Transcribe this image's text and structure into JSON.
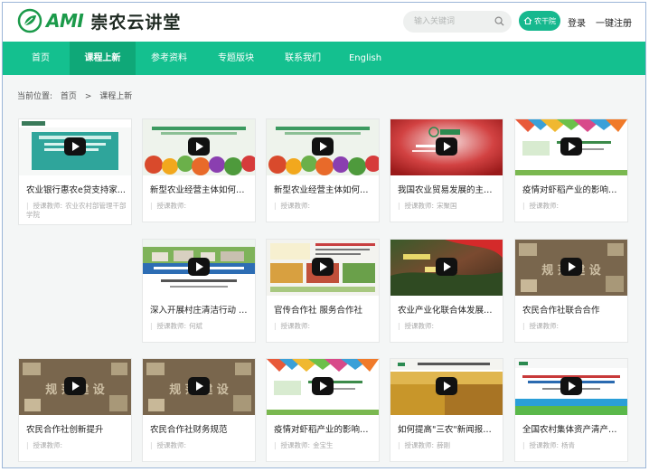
{
  "header": {
    "logo_text": "AMI",
    "site_name": "崇农云讲堂",
    "search_placeholder": "输入关键词",
    "home_button": "农干院",
    "login": "登录",
    "register": "一键注册"
  },
  "nav": {
    "items": [
      {
        "label": "首页",
        "active": false
      },
      {
        "label": "课程上新",
        "active": true
      },
      {
        "label": "参考资料",
        "active": false
      },
      {
        "label": "专题版块",
        "active": false
      },
      {
        "label": "联系我们",
        "active": false
      },
      {
        "label": "English",
        "active": false
      }
    ]
  },
  "breadcrumb": {
    "prefix": "当前位置:",
    "home": "首页",
    "separator": ">",
    "current": "课程上新"
  },
  "colors": {
    "brand_green": "#14c08f",
    "nav_active": "#0fa878",
    "logo_green": "#1b9a4a"
  },
  "courses": [
    {
      "title": "农业银行惠农e贷支持家...",
      "teacher_label": "授课教师:",
      "teacher": "农业农村部管理干部学院",
      "thumb": "teal-slide"
    },
    {
      "title": "新型农业经营主体如何应...",
      "teacher_label": "授课教师:",
      "teacher": "",
      "thumb": "veg"
    },
    {
      "title": "新型农业经营主体如何应...",
      "teacher_label": "授课教师:",
      "teacher": "",
      "thumb": "veg"
    },
    {
      "title": "我国农业贸易发展的主要...",
      "teacher_label": "授课教师:",
      "teacher": "宋聚国",
      "thumb": "red-ami"
    },
    {
      "title": "疫情对虾稻产业的影响及...",
      "teacher_label": "授课教师:",
      "teacher": "",
      "thumb": "triangles"
    },
    {
      "title": "深入开展村庄清洁行动 持...",
      "teacher_label": "授课教师:",
      "teacher": "何斌",
      "thumb": "village"
    },
    {
      "title": "官传合作社 服务合作社",
      "teacher_label": "授课教师:",
      "teacher": "",
      "thumb": "coop"
    },
    {
      "title": "农业产业化联合体发展模式",
      "teacher_label": "授课教师:",
      "teacher": "",
      "thumb": "red-landscape"
    },
    {
      "title": "农民合作社联合合作",
      "teacher_label": "授课教师:",
      "teacher": "",
      "thumb": "brown-calligraphy"
    },
    {
      "title": "农民合作社创新提升",
      "teacher_label": "授课教师:",
      "teacher": "",
      "thumb": "brown-calligraphy"
    },
    {
      "title": "农民合作社财务规范",
      "teacher_label": "授课教师:",
      "teacher": "",
      "thumb": "brown-calligraphy"
    },
    {
      "title": "疫情对虾稻产业的影响及...",
      "teacher_label": "授课教师:",
      "teacher": "金宝生",
      "thumb": "triangles"
    },
    {
      "title": "如何提高\"三农\"新闻报道...",
      "teacher_label": "授课教师:",
      "teacher": "薛刚",
      "thumb": "wheat"
    },
    {
      "title": "全国农村集体资产清产核...",
      "teacher_label": "授课教师:",
      "teacher": "杨青",
      "thumb": "blue-slide"
    }
  ]
}
